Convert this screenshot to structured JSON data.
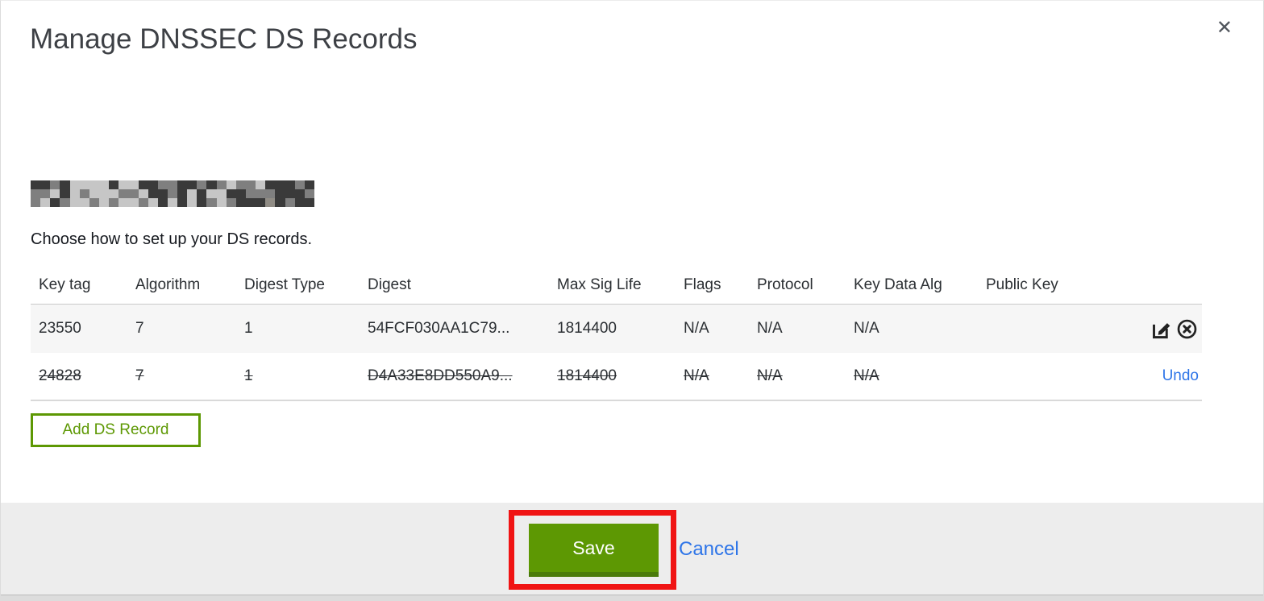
{
  "modal": {
    "title": "Manage DNSSEC DS Records",
    "close_label": "✕",
    "domain_redacted": true,
    "instruction": "Choose how to set up your DS records."
  },
  "table": {
    "columns": [
      "Key tag",
      "Algorithm",
      "Digest Type",
      "Digest",
      "Max Sig Life",
      "Flags",
      "Protocol",
      "Key Data Alg",
      "Public Key"
    ],
    "rows": [
      {
        "key_tag": "23550",
        "algorithm": "7",
        "digest_type": "1",
        "digest": "54FCF030AA1C79...",
        "max_sig_life": "1814400",
        "flags": "N/A",
        "protocol": "N/A",
        "key_data_alg": "N/A",
        "public_key": "",
        "state": "normal",
        "actions": [
          "edit-icon",
          "delete-icon"
        ]
      },
      {
        "key_tag": "24828",
        "algorithm": "7",
        "digest_type": "1",
        "digest": "D4A33E8DD550A9...",
        "max_sig_life": "1814400",
        "flags": "N/A",
        "protocol": "N/A",
        "key_data_alg": "N/A",
        "public_key": "",
        "state": "deleted",
        "undo_label": "Undo"
      }
    ]
  },
  "buttons": {
    "add_ds_record": "Add DS Record",
    "save": "Save",
    "cancel": "Cancel"
  },
  "colors": {
    "action_green": "#5d9803",
    "action_green_dark": "#4a7a0a",
    "link_blue": "#2e75e8",
    "annotation_red": "#f01414",
    "footer_bg": "#ededed",
    "row_alt_bg": "#f6f6f6",
    "title_gray": "#3d4045"
  }
}
